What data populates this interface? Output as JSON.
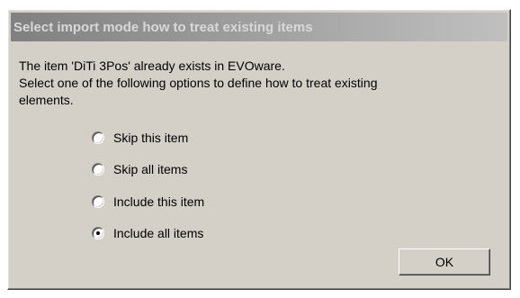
{
  "dialog": {
    "title": "Select import mode how to treat existing items",
    "message_line1": "The item 'DiTi 3Pos' already exists in EVOware.",
    "message_line2": "Select one of the following options to define how to treat existing",
    "message_line3": "elements.",
    "options": [
      {
        "label": "Skip this item",
        "selected": false
      },
      {
        "label": "Skip all items",
        "selected": false
      },
      {
        "label": "Include this item",
        "selected": false
      },
      {
        "label": "Include all items",
        "selected": true
      }
    ],
    "ok_label": "OK"
  },
  "colors": {
    "dialog_background": "#d4d0c8",
    "titlebar_inactive_start": "#808080",
    "titlebar_inactive_end": "#c0c0c0"
  }
}
